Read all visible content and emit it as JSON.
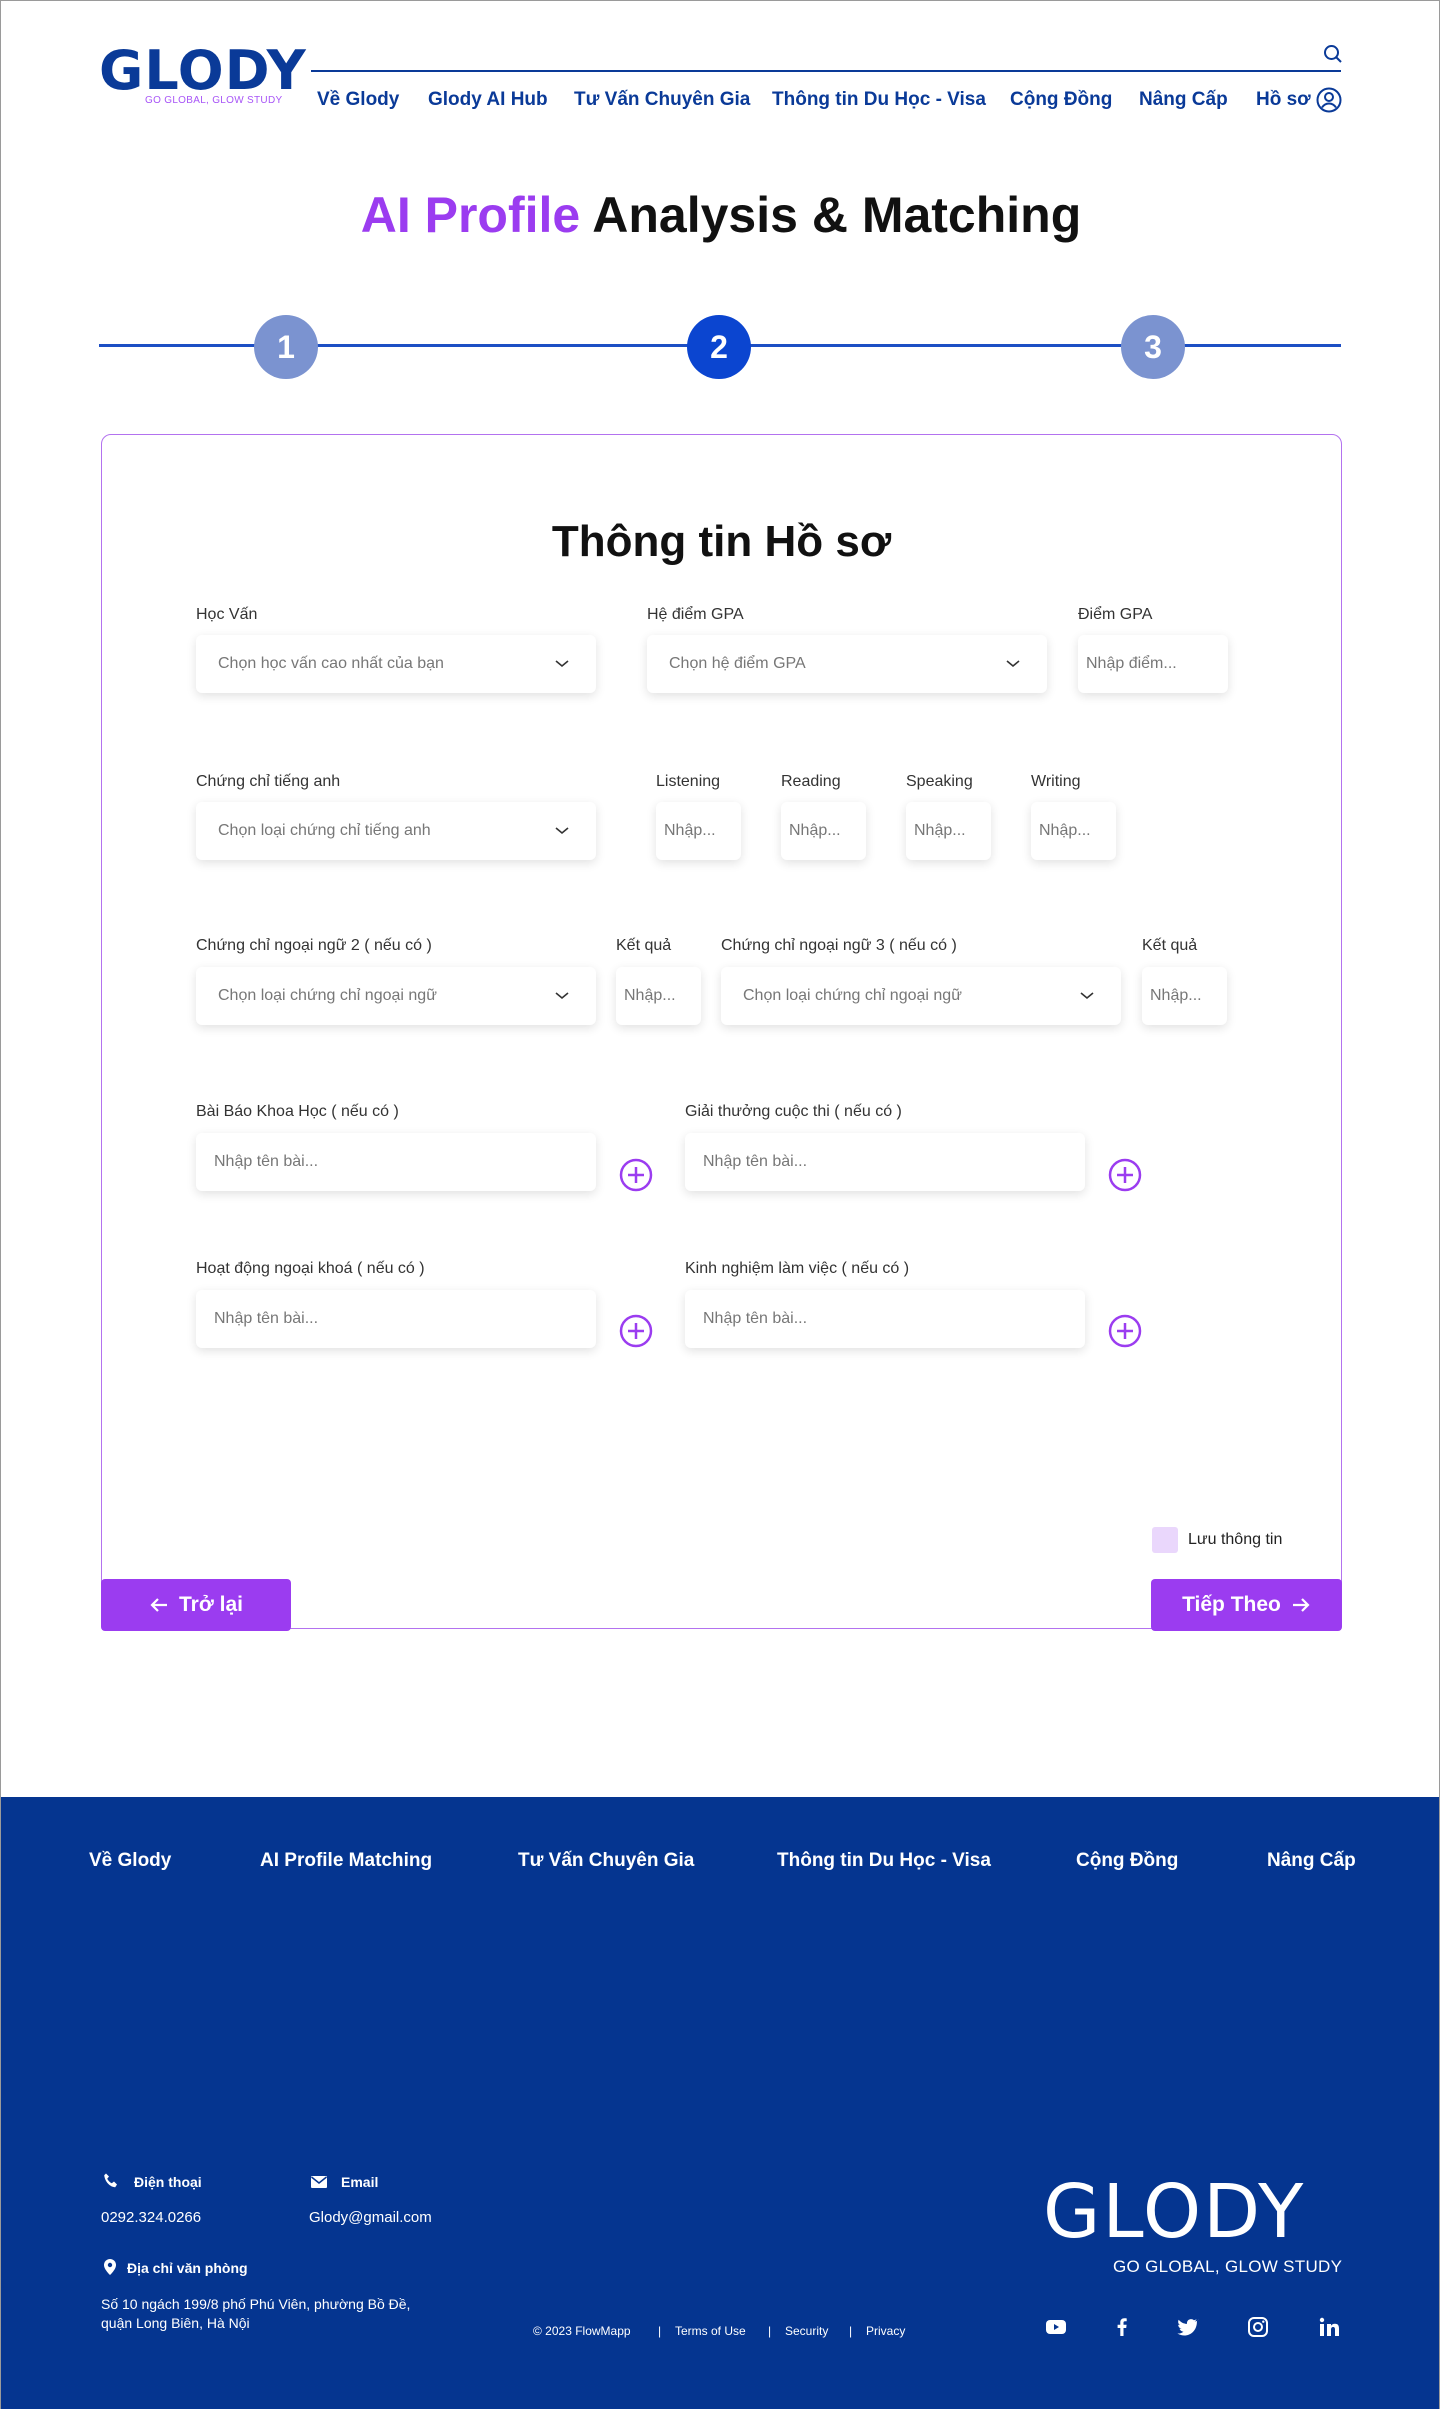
{
  "brand": {
    "name": "GLODY",
    "tagline": "GO GLOBAL, GLOW STUDY"
  },
  "header": {
    "nav": [
      "Về Glody",
      "Glody AI Hub",
      "Tư Vấn Chuyên Gia",
      "Thông tin Du Học - Visa",
      "Cộng Đồng",
      "Nâng Cấp",
      "Hồ sơ"
    ]
  },
  "hero": {
    "title_accent": "AI Profile",
    "title_rest": "Analysis & Matching"
  },
  "stepper": {
    "steps": [
      "1",
      "2",
      "3"
    ],
    "active": 2
  },
  "form": {
    "title": "Thông tin Hồ sơ",
    "education": {
      "label": "Học Vấn",
      "placeholder": "Chọn học vấn cao nhất của bạn"
    },
    "gpa_system": {
      "label": "Hệ điểm GPA",
      "placeholder": "Chọn hệ điểm GPA"
    },
    "gpa": {
      "label": "Điểm GPA",
      "placeholder": "Nhập điểm..."
    },
    "english_cert": {
      "label": "Chứng chỉ tiếng anh",
      "placeholder": "Chọn loại chứng chỉ tiếng anh"
    },
    "listening": {
      "label": "Listening",
      "placeholder": "Nhập..."
    },
    "reading": {
      "label": "Reading",
      "placeholder": "Nhập..."
    },
    "speaking": {
      "label": "Speaking",
      "placeholder": "Nhập..."
    },
    "writing": {
      "label": "Writing",
      "placeholder": "Nhập..."
    },
    "lang2": {
      "label": "Chứng chỉ ngoại ngữ 2 ( nếu có )",
      "placeholder": "Chọn loại chứng chỉ ngoại ngữ"
    },
    "lang2_result": {
      "label": "Kết quả",
      "placeholder": "Nhập..."
    },
    "lang3": {
      "label": "Chứng chỉ ngoại ngữ 3 ( nếu có )",
      "placeholder": "Chọn loại chứng chỉ ngoại ngữ"
    },
    "lang3_result": {
      "label": "Kết quả",
      "placeholder": "Nhập..."
    },
    "papers": {
      "label": "Bài Báo Khoa Học ( nếu có )",
      "placeholder": "Nhập tên bài..."
    },
    "awards": {
      "label": "Giải thưởng cuộc thi ( nếu có )",
      "placeholder": "Nhập tên bài..."
    },
    "activities": {
      "label": "Hoạt động ngoại khoá ( nếu có )",
      "placeholder": "Nhập tên bài..."
    },
    "experience": {
      "label": "Kinh nghiệm làm việc ( nếu có )",
      "placeholder": "Nhập tên bài..."
    },
    "save_label": "Lưu thông tin",
    "back_label": "Trở lại",
    "next_label": "Tiếp Theo"
  },
  "footer": {
    "nav": [
      "Về Glody",
      "AI Profile Matching",
      "Tư Vấn Chuyên Gia",
      "Thông tin Du Học - Visa",
      "Cộng Đồng",
      "Nâng Cấp"
    ],
    "phone_label": "Điện thoại",
    "phone": "0292.324.0266",
    "email_label": "Email",
    "email": "Glody@gmail.com",
    "address_label": "Địa chỉ văn phòng",
    "address": "Số 10 ngách 199/8 phố Phú Viên, phường Bồ Đề, quận Long Biên, Hà Nội",
    "copyright": "© 2023 FlowMapp",
    "legal": [
      "Terms of Use",
      "Security",
      "Privacy"
    ],
    "social": [
      "youtube-icon",
      "facebook-icon",
      "twitter-icon",
      "instagram-icon",
      "linkedin-icon"
    ]
  },
  "colors": {
    "brand_blue": "#0a3a98",
    "accent_purple": "#9b3cf0",
    "footer_bg": "#053590",
    "step_active": "#0b45d0",
    "step_done": "#7b93d0"
  }
}
